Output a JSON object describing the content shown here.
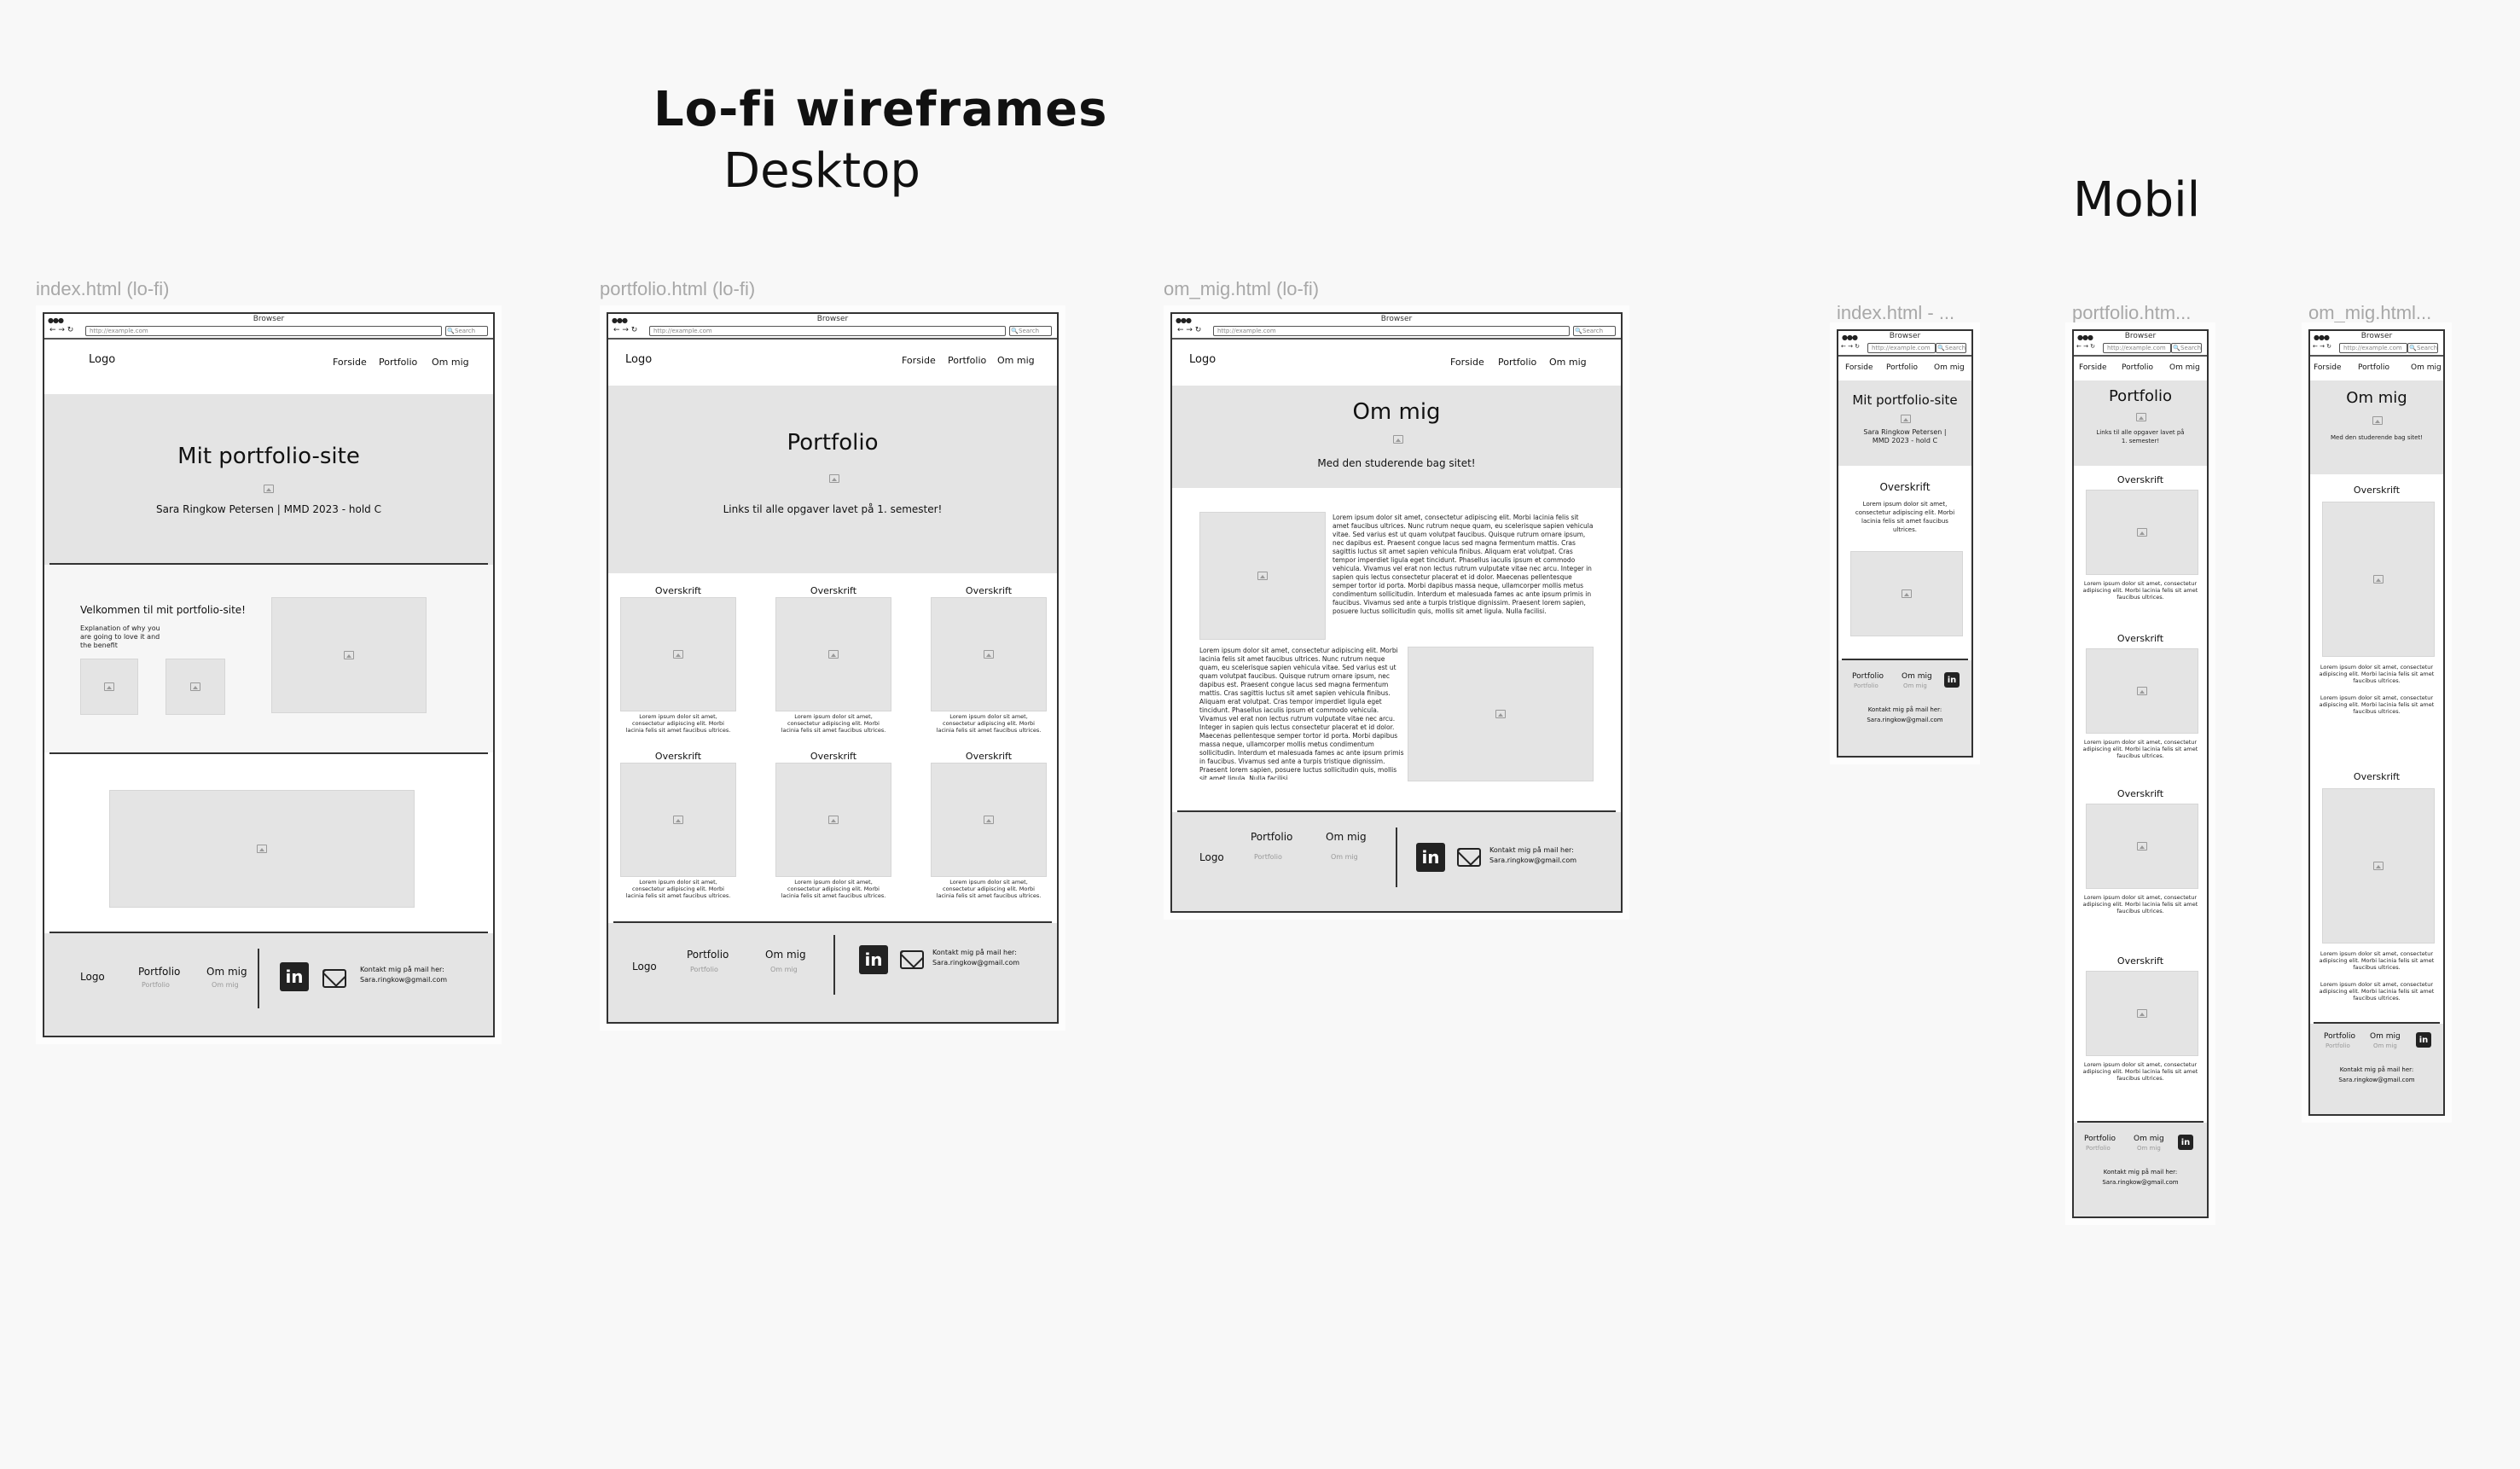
{
  "heading": {
    "title": "Lo-fi wireframes",
    "desktop": "Desktop",
    "mobile": "Mobil"
  },
  "frames": {
    "index": "index.html (lo-fi)",
    "portfolio": "portfolio.html (lo-fi)",
    "om_mig": "om_mig.html (lo-fi)",
    "m_index": "index.html - ...",
    "m_portfolio": "portfolio.htm...",
    "m_om_mig": "om_mig.html..."
  },
  "browser": {
    "title": "Browser",
    "url": "http://example.com",
    "search": "Search",
    "nav": "← → ↻",
    "dots": "●●●"
  },
  "nav": {
    "logo": "Logo",
    "forside": "Forside",
    "portfolio": "Portfolio",
    "om_mig": "Om mig"
  },
  "index": {
    "hero_title": "Mit portfolio-site",
    "hero_sub": "Sara Ringkow Petersen | MMD 2023 - hold C",
    "welcome": "Velkommen til mit portfolio-site!",
    "explanation": "Explanation of why you are going to love it and the benefit"
  },
  "portfolio": {
    "hero_title": "Portfolio",
    "hero_sub": "Links til alle opgaver lavet på 1. semester!",
    "card_title": "Overskrift",
    "card_text": "Lorem ipsum dolor sit amet, consectetur adipiscing elit. Morbi lacinia felis sit amet faucibus ultrices."
  },
  "om_mig": {
    "hero_title": "Om mig",
    "hero_sub": "Med den studerende bag sitet!",
    "p1": "Lorem ipsum dolor sit amet, consectetur adipiscing elit. Morbi lacinia felis sit amet faucibus ultrices. Nunc rutrum neque quam, eu scelerisque sapien vehicula vitae. Sed varius est ut quam volutpat faucibus. Quisque rutrum ornare ipsum, nec dapibus est. Praesent congue lacus sed magna fermentum mattis. Cras sagittis luctus sit amet sapien vehicula finibus. Aliquam erat volutpat. Cras tempor imperdiet ligula eget tincidunt. Phasellus iaculis ipsum et commodo vehicula. Vivamus vel erat non lectus rutrum vulputate vitae nec arcu. Integer in sapien quis lectus consectetur placerat et id dolor. Maecenas pellentesque semper tortor id porta. Morbi dapibus massa neque, ullamcorper mollis metus condimentum sollicitudin. Interdum et malesuada fames ac ante ipsum primis in faucibus. Vivamus sed ante a turpis tristique dignissim. Praesent lorem sapien, posuere luctus sollicitudin quis, mollis sit amet ligula. Nulla facilisi.",
    "p2": "Lorem ipsum dolor sit amet, consectetur adipiscing elit. Morbi lacinia felis sit amet faucibus ultrices. Nunc rutrum neque quam, eu scelerisque sapien vehicula vitae. Sed varius est ut quam volutpat faucibus. Quisque rutrum ornare ipsum, nec dapibus est. Praesent congue lacus sed magna fermentum mattis. Cras sagittis luctus sit amet sapien vehicula finibus. Aliquam erat volutpat. Cras tempor imperdiet ligula eget tincidunt. Phasellus iaculis ipsum et commodo vehicula. Vivamus vel erat non lectus rutrum vulputate vitae nec arcu. Integer in sapien quis lectus consectetur placerat et id dolor. Maecenas pellentesque semper tortor id porta. Morbi dapibus massa neque, ullamcorper mollis metus condimentum sollicitudin. Interdum et malesuada fames ac ante ipsum primis in faucibus. Vivamus sed ante a turpis tristique dignissim. Praesent lorem sapien, posuere luctus sollicitudin quis, mollis sit amet ligula. Nulla facilisi."
  },
  "footer": {
    "logo": "Logo",
    "portfolio": "Portfolio",
    "om_mig": "Om mig",
    "linkedin": "in",
    "contact": "Kontakt mig på mail her:",
    "email": "Sara.ringkow@gmail.com"
  },
  "mobile": {
    "index_hero_sub": "Sara Ringkow Petersen | MMD 2023 - hold C",
    "index_text": "Lorem ipsum dolor sit amet, consectetur adipiscing elit. Morbi lacinia felis sit amet faucibus ultrices.",
    "portfolio_hero_sub": "Links til alle opgaver lavet på 1. semester!",
    "card_text": "Lorem ipsum dolor sit amet, consectetur adipiscing elit. Morbi lacinia felis sit amet faucibus ultrices.",
    "om_text": "Lorem ipsum dolor sit amet, consectetur adipiscing elit. Morbi lacinia felis sit amet faucibus ultrices.",
    "contact": "Kontakt mig på mail her:"
  }
}
